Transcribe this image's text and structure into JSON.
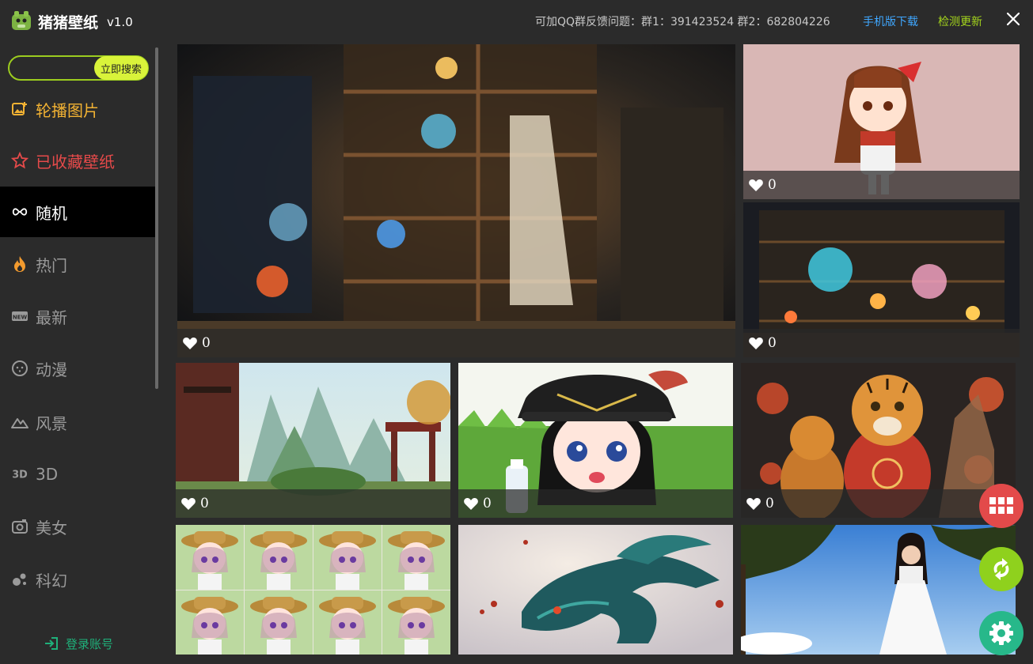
{
  "app": {
    "name": "猪猪壁纸",
    "version": "v1.0"
  },
  "header": {
    "qq_info": "可加QQ群反馈问题：群1：391423524   群2：682804226",
    "mobile_download": "手机版下载",
    "check_update": "检测更新"
  },
  "search": {
    "placeholder": "",
    "button": "立即搜索"
  },
  "sidebar": {
    "items": [
      {
        "label": "轮播图片",
        "icon": "image-plus-icon",
        "color": "#f2b233"
      },
      {
        "label": "已收藏壁纸",
        "icon": "star-icon",
        "color": "#e64a4a"
      },
      {
        "label": "随机",
        "icon": "infinity-icon",
        "color": "#ffffff"
      },
      {
        "label": "热门",
        "icon": "fire-icon",
        "color": "#f29a2e"
      },
      {
        "label": "最新",
        "icon": "new-badge-icon",
        "color": "#9a9a9a"
      },
      {
        "label": "动漫",
        "icon": "face-icon",
        "color": "#9a9a9a"
      },
      {
        "label": "风景",
        "icon": "mountain-icon",
        "color": "#9a9a9a"
      },
      {
        "label": "3D",
        "icon": "3d-icon",
        "color": "#9a9a9a"
      },
      {
        "label": "美女",
        "icon": "camera-icon",
        "color": "#9a9a9a"
      },
      {
        "label": "科幻",
        "icon": "atom-icon",
        "color": "#9a9a9a"
      }
    ],
    "active_index": 2,
    "login": "登录账号"
  },
  "cards": [
    {
      "likes": "0",
      "subject": "shop-interior"
    },
    {
      "likes": "0",
      "subject": "chibi-girl"
    },
    {
      "likes": "0",
      "subject": "fantasy-shop"
    },
    {
      "likes": "0",
      "subject": "mountain-landscape"
    },
    {
      "likes": "0",
      "subject": "anime-girl-hat"
    },
    {
      "likes": "0",
      "subject": "tigers"
    },
    {
      "likes": "",
      "subject": "chibi-grid"
    },
    {
      "likes": "",
      "subject": "dragon"
    },
    {
      "likes": "",
      "subject": "woman-white-dress"
    }
  ],
  "colors": {
    "accent_green": "#9ccc1f",
    "link_blue": "#3fa7ff",
    "update_green": "#a4d51c",
    "fab_red": "#e34a4a",
    "fab_lime": "#8fd11d",
    "fab_teal": "#27b88a"
  }
}
